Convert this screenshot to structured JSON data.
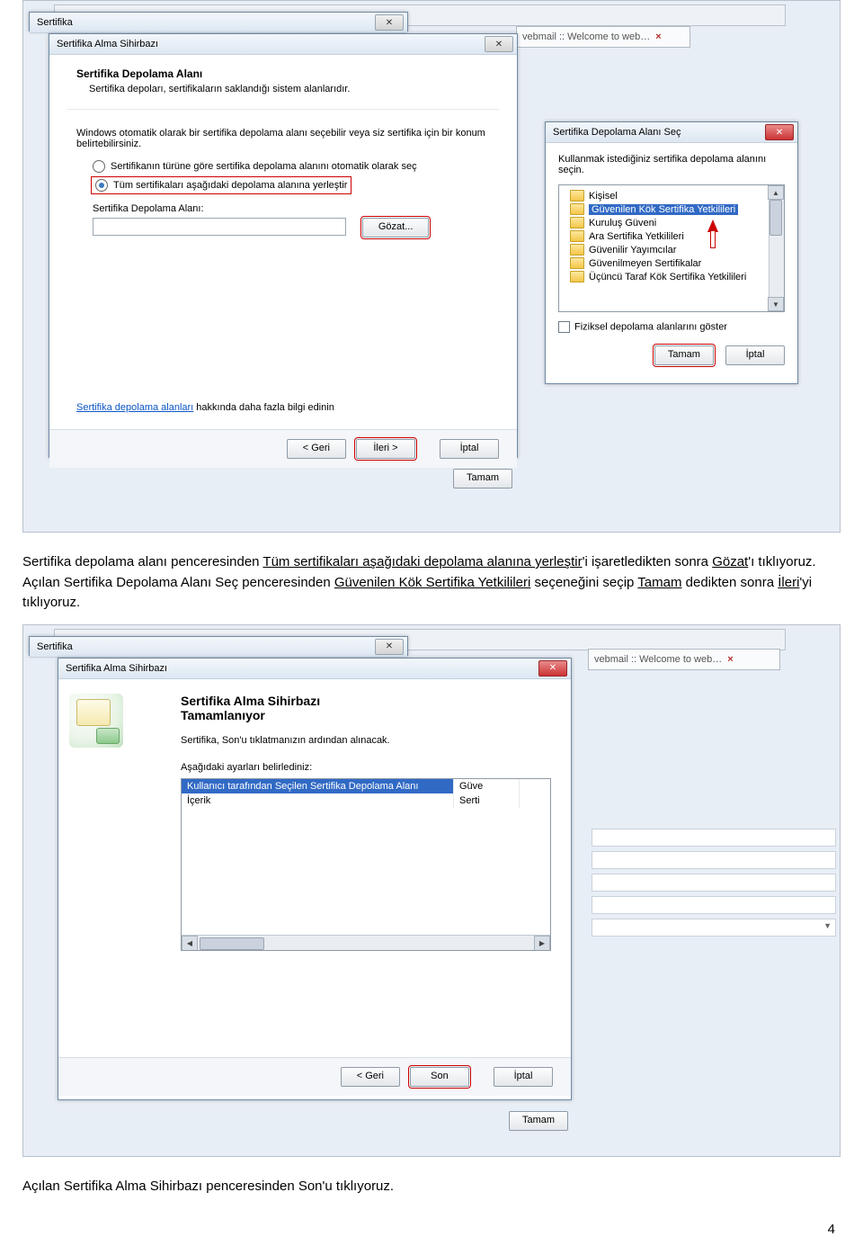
{
  "browserTab": {
    "label": "vebmail :: Welcome to web…"
  },
  "screenshot1": {
    "wizardWindow": {
      "title": "Sertifika Alma Sihirbazı",
      "heading": "Sertifika Depolama Alanı",
      "subheading": "Sertifika depoları, sertifikaların saklandığı sistem alanlarıdır.",
      "instruction": "Windows otomatik olarak bir sertifika depolama alanı seçebilir veya siz sertifika için bir konum belirtebilirsiniz.",
      "radioAuto": "Sertifikanın türüne göre sertifika depolama alanını otomatik olarak seç",
      "radioManual": "Tüm sertifikaları aşağıdaki depolama alanına yerleştir",
      "fieldLabel": "Sertifika Depolama Alanı:",
      "browseBtn": "Gözat...",
      "helpLink": "Sertifika depolama alanları",
      "helpLinkTail": " hakkında daha fazla bilgi edinin",
      "backBtn": "< Geri",
      "nextBtn": "İleri >",
      "cancelBtn": "İptal",
      "tamamBtn": "Tamam",
      "certTitle": "Sertifika"
    },
    "treeDialog": {
      "title": "Sertifika Depolama Alanı Seç",
      "instruction": "Kullanmak istediğiniz sertifika depolama alanını seçin.",
      "items": [
        "Kişisel",
        "Güvenilen Kök Sertifika Yetkilileri",
        "Kuruluş Güveni",
        "Ara Sertifika Yetkilileri",
        "Güvenilir Yayımcılar",
        "Güvenilmeyen Sertifikalar",
        "Üçüncü Taraf Kök Sertifika Yetkilileri"
      ],
      "checkbox": "Fiziksel depolama alanlarını göster",
      "okBtn": "Tamam",
      "cancelBtn": "İptal"
    }
  },
  "docParagraph1": {
    "pre": "Sertifika depolama alanı penceresinden ",
    "u1": "Tüm sertifikaları aşağıdaki depolama alanına yerleştir",
    "mid1": "'i işaretledikten sonra ",
    "u2": "Gözat",
    "mid2": "'ı tıklıyoruz. Açılan Sertifika Depolama Alanı Seç penceresinden ",
    "u3": "Güvenilen Kök Sertifika Yetkilileri",
    "mid3": " seçeneğini seçip ",
    "u4": "Tamam",
    "mid4": " dedikten sonra  ",
    "u5": "İleri",
    "tail": "'yi tıklıyoruz."
  },
  "screenshot2": {
    "wizardWindow": {
      "title": "Sertifika Alma Sihirbazı",
      "heading1": "Sertifika Alma Sihirbazı",
      "heading2": "Tamamlanıyor",
      "line1": "Sertifika, Son'u tıklatmanızın ardından alınacak.",
      "line2": "Aşağıdaki ayarları belirlediniz:",
      "listCol1Row1": "Kullanıcı tarafından Seçilen Sertifika Depolama Alanı",
      "listCol2Row1": "Güve",
      "listCol1Row2": "İçerik",
      "listCol2Row2": "Serti",
      "backBtn": "< Geri",
      "finishBtn": "Son",
      "cancelBtn": "İptal",
      "tamamBtn": "Tamam",
      "certTitle": "Sertifika"
    }
  },
  "docParagraph2": "Açılan Sertifika Alma Sihirbazı penceresinden Son'u tıklıyoruz.",
  "pageNumber": "4"
}
